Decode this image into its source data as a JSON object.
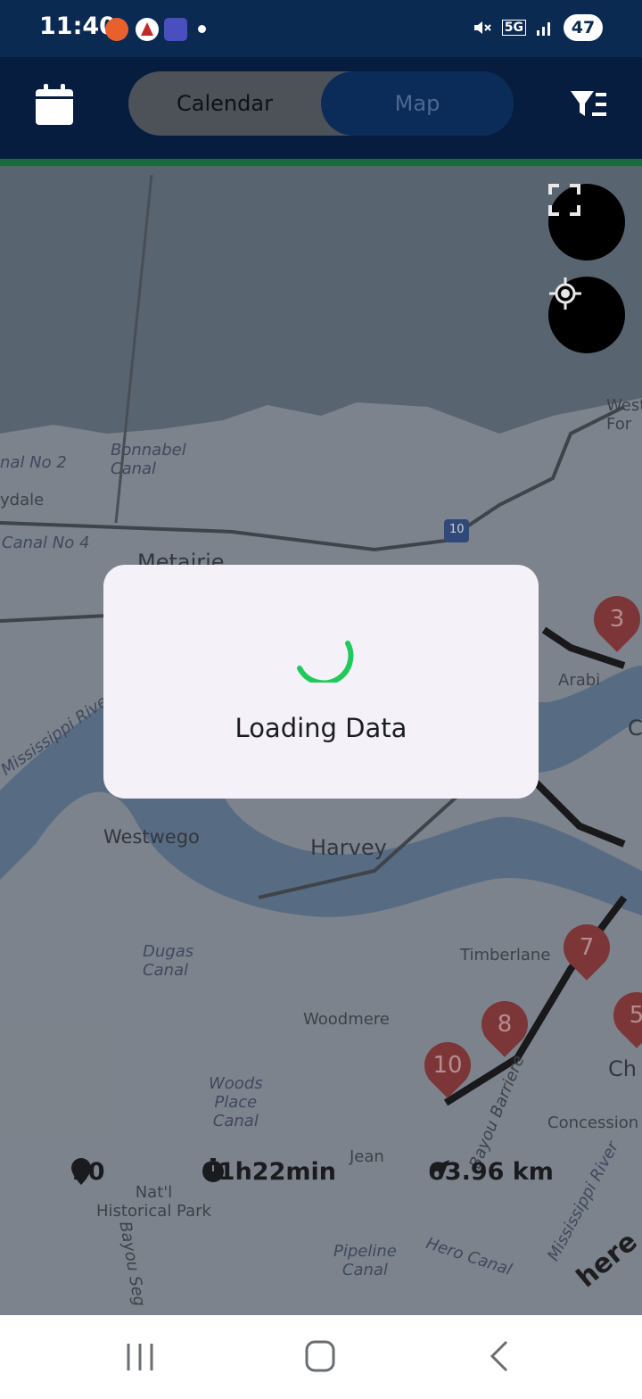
{
  "status_bar": {
    "time": "11:40",
    "network": "5G",
    "battery": "47"
  },
  "header": {
    "tabs": [
      "Calendar",
      "Map"
    ],
    "selected_tab": "Map",
    "icons": [
      "calendar-icon",
      "filter-icon"
    ]
  },
  "map": {
    "labels": {
      "bonnabel": "Bonnabel\nCanal",
      "canal2": "nal No 2",
      "ydale": "ydale",
      "canal4": "Canal No 4",
      "metairie": "Metairie",
      "arabi": "Arabi",
      "westwego": "Westwego",
      "harvey": "Harvey",
      "dugas": "Dugas\nCanal",
      "timberlane": "Timberlane",
      "woodmere": "Woodmere",
      "woods": "Woods\nPlace\nCanal",
      "historical": "Nat'l\nHistorical Park",
      "pipeline": "Pipeline\nCanal",
      "hero": "Hero Canal",
      "concession": "Concession",
      "mississippi1": "Mississippi River",
      "mississippi2": "Mississippi River",
      "westfor": "West\nFor",
      "here": "here",
      "highway": "10",
      "bayou_barriere": "Bayou Barriere",
      "bayou_seg": "Bayou Seg",
      "jean": "Jean",
      "ch": "Ch",
      "c_right": "C"
    },
    "markers": [
      "3",
      "7",
      "8",
      "10",
      "5"
    ],
    "buttons": [
      "fullscreen-icon",
      "my-location-icon"
    ],
    "accent_marker": "#8e3030"
  },
  "stats": {
    "stops": "10",
    "duration": "01h22min",
    "distance": "63.96 km"
  },
  "dialog": {
    "message": "Loading Data",
    "spinner_color": "#1fc95a"
  },
  "nav": {
    "icons": [
      "recent-apps-icon",
      "home-icon",
      "back-icon"
    ]
  }
}
